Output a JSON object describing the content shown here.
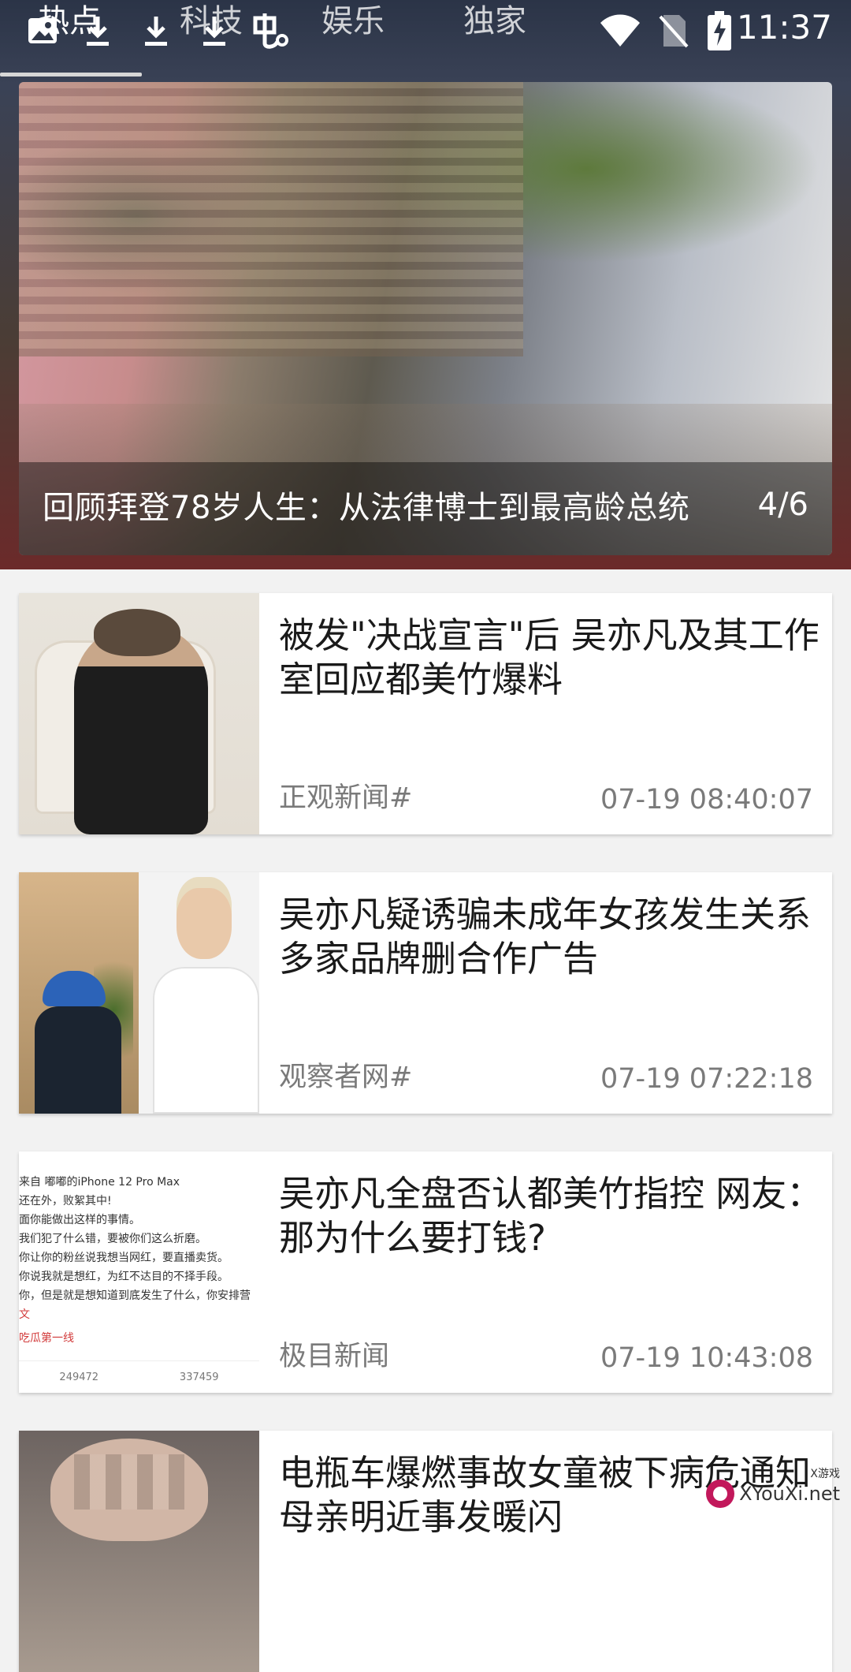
{
  "tabs": [
    {
      "label": "热点"
    },
    {
      "label": "科技"
    },
    {
      "label": "娱乐"
    },
    {
      "label": "独家"
    }
  ],
  "status_bar": {
    "time": "11:37",
    "icons": [
      "image-icon",
      "download-icon",
      "download-icon",
      "download-icon",
      "app-icon",
      "wifi-icon",
      "no-sim-icon",
      "battery-charging-icon"
    ]
  },
  "hero": {
    "title": "回顾拜登78岁人生：从法律博士到最高龄总统",
    "counter": "4/6"
  },
  "news": [
    {
      "title": "被发\"决战宣言\"后 吴亦凡及其工作室回应都美竹爆料",
      "source": "正观新闻#",
      "time": "07-19 08:40:07"
    },
    {
      "title": "吴亦凡疑诱骗未成年女孩发生关系 多家品牌删合作广告",
      "source": "观察者网#",
      "time": "07-19 07:22:18"
    },
    {
      "title": "吴亦凡全盘否认都美竹指控 网友：那为什么要打钱?",
      "source": "极目新闻",
      "time": "07-19 10:43:08"
    },
    {
      "title": "电瓶车爆燃事故女童被下病危通知 母亲明近事发暖闪",
      "source": "",
      "time": ""
    }
  ],
  "thumb3": {
    "lines": [
      "来自 嘟嘟的iPhone 12 Pro Max",
      "还在外，败絮其中!",
      "面你能做出这样的事情。",
      "我们犯了什么错，要被你们这么折磨。",
      "你让你的粉丝说我想当网红，要直播卖货。",
      "你说我就是想红，为红不达目的不择手段。",
      "你，但是就是想知道到底发生了什么，你安排营",
      "文",
      "吃瓜第一线"
    ],
    "reposts": "249472",
    "comments": "337459"
  },
  "watermark": {
    "text": "XYouXi.net",
    "sub": "X游戏"
  }
}
